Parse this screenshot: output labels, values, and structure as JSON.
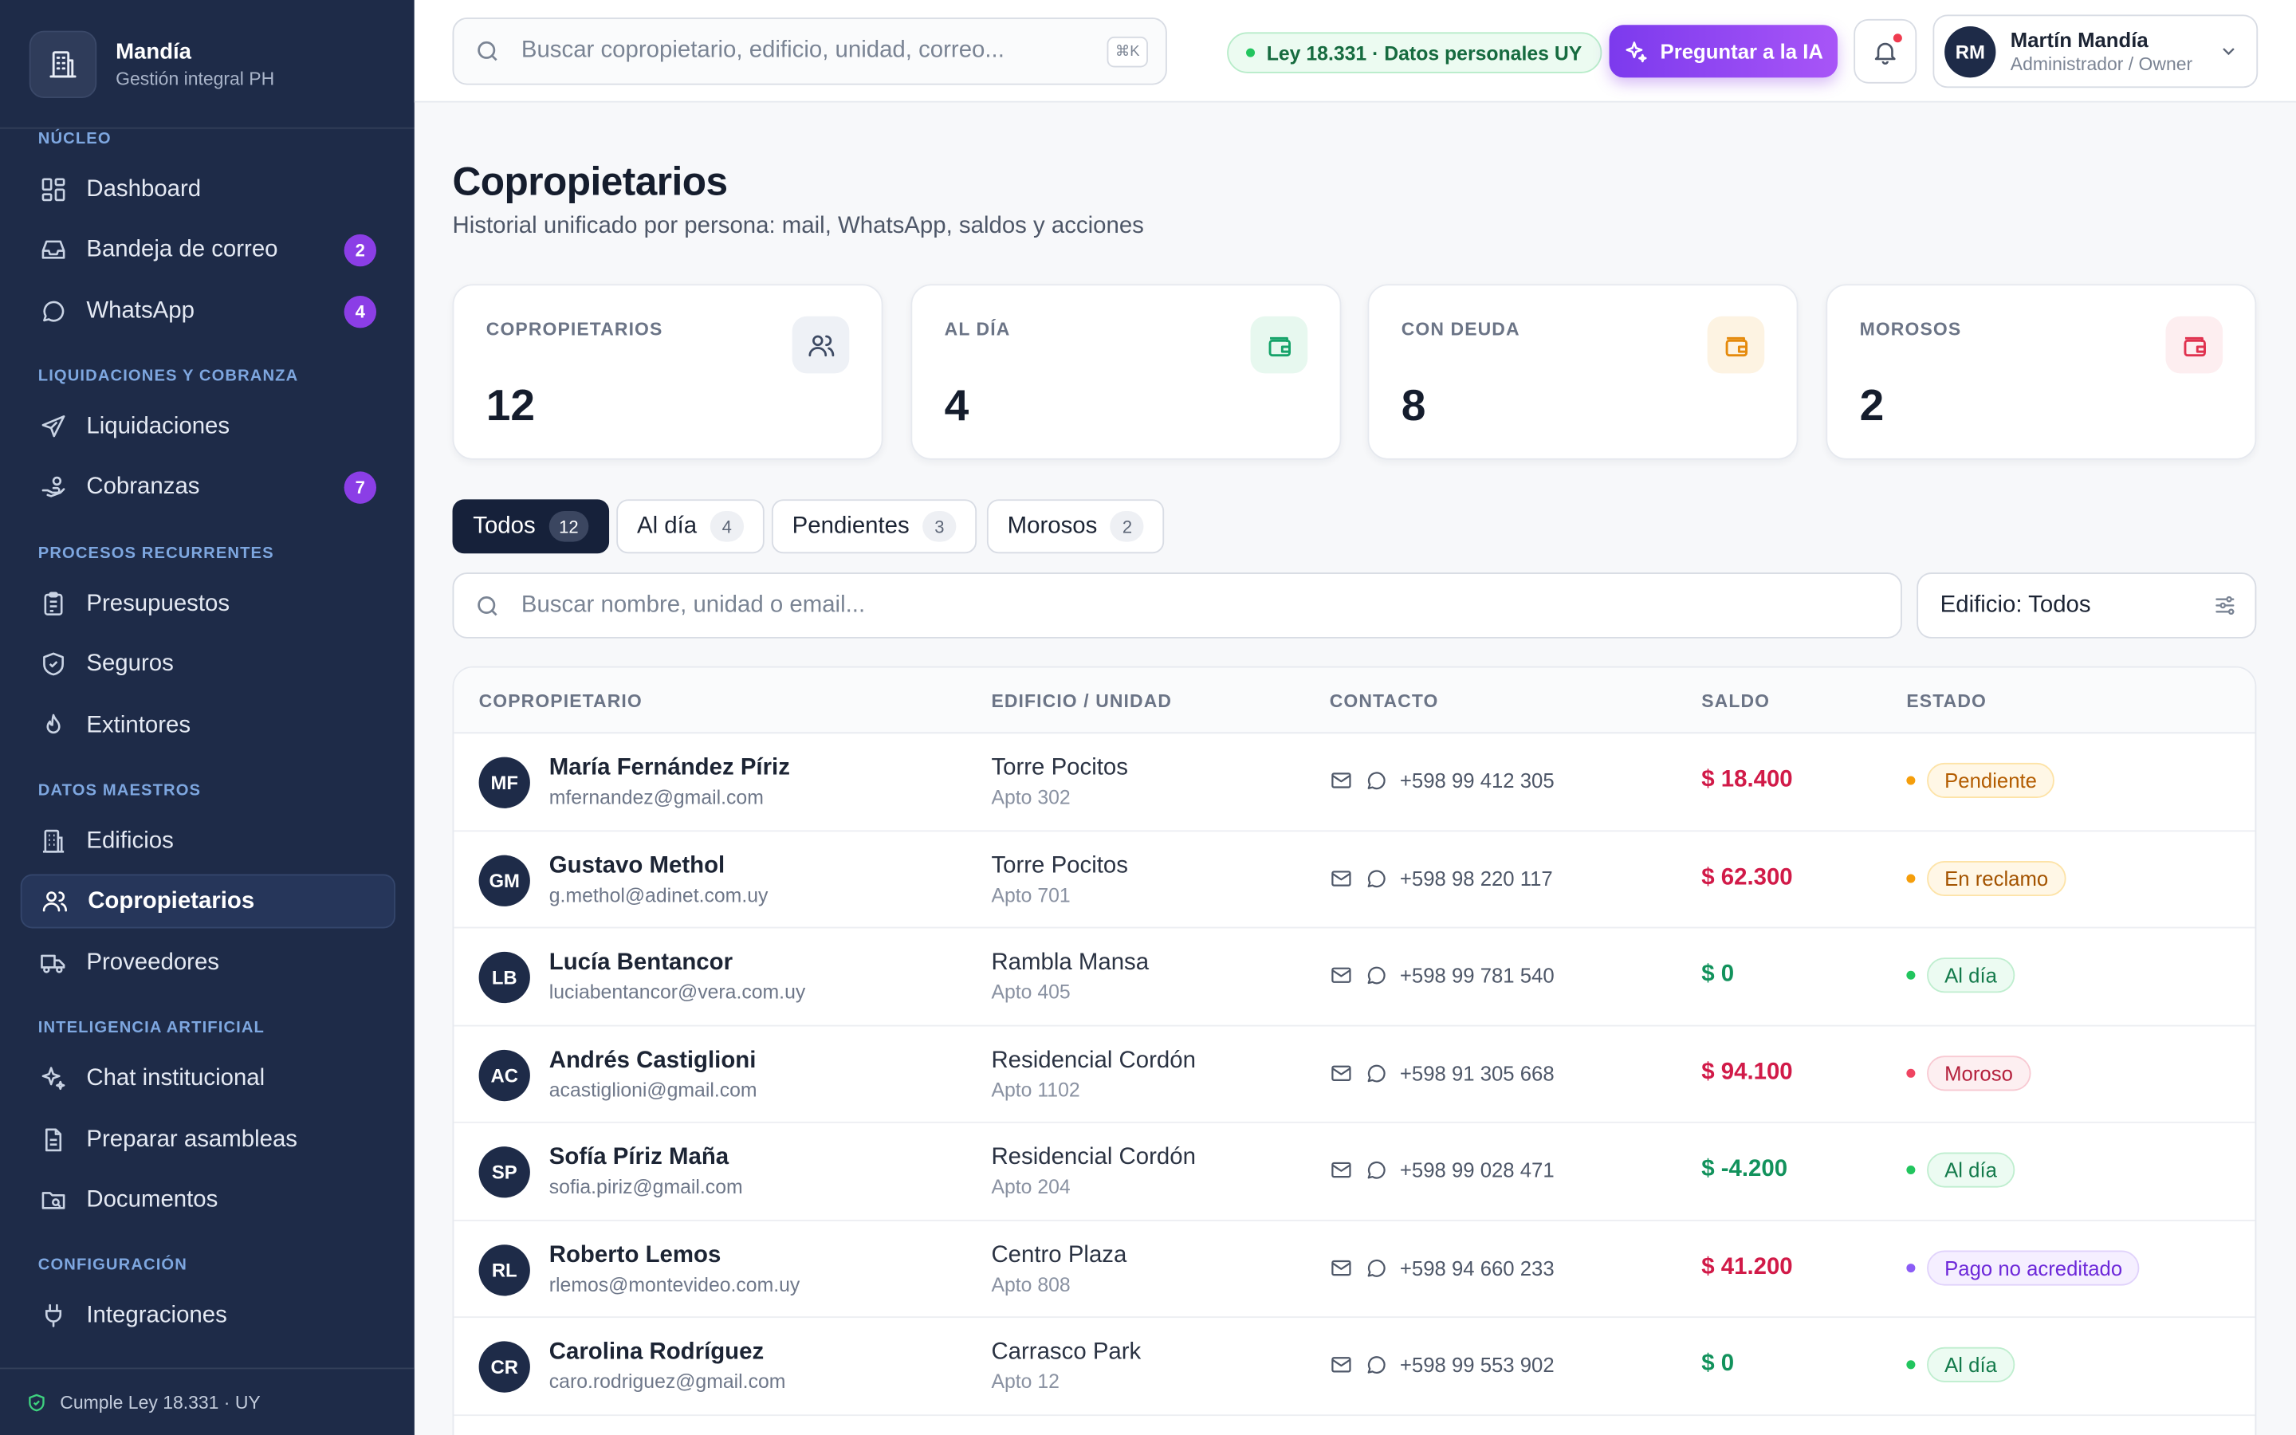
{
  "brand": {
    "name": "Mandía",
    "subtitle": "Gestión integral PH"
  },
  "sidebar": {
    "sections": [
      {
        "label": "NÚCLEO"
      },
      {
        "label": "LIQUIDACIONES Y COBRANZA"
      },
      {
        "label": "PROCESOS RECURRENTES"
      },
      {
        "label": "DATOS MAESTROS"
      },
      {
        "label": "INTELIGENCIA ARTIFICIAL"
      },
      {
        "label": "CONFIGURACIÓN"
      }
    ],
    "items": [
      {
        "label": "Dashboard",
        "icon": "dashboard-icon"
      },
      {
        "label": "Bandeja de correo",
        "icon": "inbox-icon",
        "badge": "2"
      },
      {
        "label": "WhatsApp",
        "icon": "chat-bubble-icon",
        "badge": "4"
      },
      {
        "label": "Liquidaciones",
        "icon": "send-icon"
      },
      {
        "label": "Cobranzas",
        "icon": "hand-coins-icon",
        "badge": "7"
      },
      {
        "label": "Presupuestos",
        "icon": "clipboard-icon"
      },
      {
        "label": "Seguros",
        "icon": "shield-icon"
      },
      {
        "label": "Extintores",
        "icon": "flame-icon"
      },
      {
        "label": "Edificios",
        "icon": "building-icon"
      },
      {
        "label": "Copropietarios",
        "icon": "users-icon",
        "active": true
      },
      {
        "label": "Proveedores",
        "icon": "truck-icon"
      },
      {
        "label": "Chat institucional",
        "icon": "sparkles-icon"
      },
      {
        "label": "Preparar asambleas",
        "icon": "document-icon"
      },
      {
        "label": "Documentos",
        "icon": "folder-search-icon"
      },
      {
        "label": "Integraciones",
        "icon": "plug-icon"
      }
    ],
    "footer": "Cumple Ley 18.331 · UY"
  },
  "topbar": {
    "search_placeholder": "Buscar copropietario, edificio, unidad, correo...",
    "shortcut": "⌘K",
    "law_chip": "Ley 18.331 · Datos personales UY",
    "ai_button": "Preguntar a la IA",
    "user": {
      "initials": "RM",
      "name": "Martín Mandía",
      "role": "Administrador / Owner"
    }
  },
  "page": {
    "title": "Copropietarios",
    "subtitle": "Historial unificado por persona: mail, WhatsApp, saldos y acciones"
  },
  "stats": [
    {
      "label": "COPROPIETARIOS",
      "value": "12",
      "icon": "users-icon",
      "color": "#3d4a63",
      "bg": "#eef1f6"
    },
    {
      "label": "AL DÍA",
      "value": "4",
      "icon": "wallet-icon",
      "color": "#16a36a",
      "bg": "#e7f8ef"
    },
    {
      "label": "CON DEUDA",
      "value": "8",
      "icon": "wallet-icon",
      "color": "#e58a0c",
      "bg": "#fdf3e2"
    },
    {
      "label": "MOROSOS",
      "value": "2",
      "icon": "wallet-icon",
      "color": "#e0324f",
      "bg": "#fdeef0"
    }
  ],
  "tabs": [
    {
      "label": "Todos",
      "count": "12",
      "active": true
    },
    {
      "label": "Al día",
      "count": "4"
    },
    {
      "label": "Pendientes",
      "count": "3"
    },
    {
      "label": "Morosos",
      "count": "2"
    }
  ],
  "list_search_placeholder": "Buscar nombre, unidad o email...",
  "building_filter": "Edificio: Todos",
  "table": {
    "headers": [
      "COPROPIETARIO",
      "EDIFICIO / UNIDAD",
      "CONTACTO",
      "SALDO",
      "ESTADO"
    ],
    "rows": [
      {
        "initials": "MF",
        "name": "María Fernández Píriz",
        "email": "mfernandez@gmail.com",
        "building": "Torre Pocitos",
        "unit": "Apto 302",
        "phone": "+598 99 412 305",
        "balance": "$ 18.400",
        "balance_color": "#d11a48",
        "status": "Pendiente",
        "status_color": "#b35c00",
        "status_bg": "#fff7e6",
        "status_border": "#fde3a7",
        "dot": "#f59e0b"
      },
      {
        "initials": "GM",
        "name": "Gustavo Methol",
        "email": "g.methol@adinet.com.uy",
        "building": "Torre Pocitos",
        "unit": "Apto 701",
        "phone": "+598 98 220 117",
        "balance": "$ 62.300",
        "balance_color": "#d11a48",
        "status": "En reclamo",
        "status_color": "#a35300",
        "status_bg": "#fff7e6",
        "status_border": "#fde3a7",
        "dot": "#f59e0b"
      },
      {
        "initials": "LB",
        "name": "Lucía Bentancor",
        "email": "luciabentancor@vera.com.uy",
        "building": "Rambla Mansa",
        "unit": "Apto 405",
        "phone": "+598 99 781 540",
        "balance": "$ 0",
        "balance_color": "#12925c",
        "status": "Al día",
        "status_color": "#137a4b",
        "status_bg": "#ecfbf2",
        "status_border": "#bfeecf",
        "dot": "#22c55e"
      },
      {
        "initials": "AC",
        "name": "Andrés Castiglioni",
        "email": "acastiglioni@gmail.com",
        "building": "Residencial Cordón",
        "unit": "Apto 1102",
        "phone": "+598 91 305 668",
        "balance": "$ 94.100",
        "balance_color": "#d11a48",
        "status": "Moroso",
        "status_color": "#b4213d",
        "status_bg": "#fdeff1",
        "status_border": "#f8c9d2",
        "dot": "#ef4461"
      },
      {
        "initials": "SP",
        "name": "Sofía Píriz Maña",
        "email": "sofia.piriz@gmail.com",
        "building": "Residencial Cordón",
        "unit": "Apto 204",
        "phone": "+598 99 028 471",
        "balance": "$ -4.200",
        "balance_color": "#12925c",
        "status": "Al día",
        "status_color": "#137a4b",
        "status_bg": "#ecfbf2",
        "status_border": "#bfeecf",
        "dot": "#22c55e"
      },
      {
        "initials": "RL",
        "name": "Roberto Lemos",
        "email": "rlemos@montevideo.com.uy",
        "building": "Centro Plaza",
        "unit": "Apto 808",
        "phone": "+598 94 660 233",
        "balance": "$ 41.200",
        "balance_color": "#d11a48",
        "status": "Pago no acreditado",
        "status_color": "#6d28d9",
        "status_bg": "#f5efff",
        "status_border": "#e0d2fb",
        "dot": "#8b5cf6"
      },
      {
        "initials": "CR",
        "name": "Carolina Rodríguez",
        "email": "caro.rodriguez@gmail.com",
        "building": "Carrasco Park",
        "unit": "Apto 12",
        "phone": "+598 99 553 902",
        "balance": "$ 0",
        "balance_color": "#12925c",
        "status": "Al día",
        "status_color": "#137a4b",
        "status_bg": "#ecfbf2",
        "status_border": "#bfeecf",
        "dot": "#22c55e"
      }
    ]
  }
}
